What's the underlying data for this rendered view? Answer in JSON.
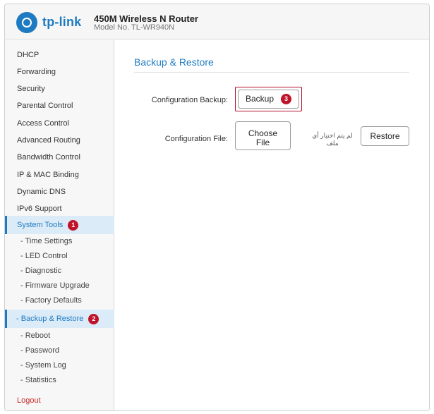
{
  "header": {
    "brand": "tp-link",
    "product_name": "450M Wireless N Router",
    "model": "Model No. TL-WR940N",
    "brand_color": "#1f7bc1"
  },
  "sidebar": {
    "items": [
      {
        "label": "DHCP"
      },
      {
        "label": "Forwarding"
      },
      {
        "label": "Security"
      },
      {
        "label": "Parental Control"
      },
      {
        "label": "Access Control"
      },
      {
        "label": "Advanced Routing"
      },
      {
        "label": "Bandwidth Control"
      },
      {
        "label": "IP & MAC Binding"
      },
      {
        "label": "Dynamic DNS"
      },
      {
        "label": "IPv6 Support"
      },
      {
        "label": "System Tools",
        "badge": "1"
      },
      {
        "label": "- Time Settings"
      },
      {
        "label": "- LED Control"
      },
      {
        "label": "- Diagnostic"
      },
      {
        "label": "- Firmware Upgrade"
      },
      {
        "label": "- Factory Defaults"
      },
      {
        "label": "- Backup & Restore",
        "badge": "2"
      },
      {
        "label": "- Reboot"
      },
      {
        "label": "- Password"
      },
      {
        "label": "- System Log"
      },
      {
        "label": "- Statistics"
      },
      {
        "label": "Logout"
      }
    ]
  },
  "main": {
    "title": "Backup & Restore",
    "config_backup_label": "Configuration Backup:",
    "backup_button": "Backup",
    "backup_badge": "3",
    "config_file_label": "Configuration File:",
    "choose_file_line1": "Choose",
    "choose_file_line2": "File",
    "no_file_line1": "لم يتم اختيار أي",
    "no_file_line2": "ملف",
    "restore_button": "Restore"
  }
}
